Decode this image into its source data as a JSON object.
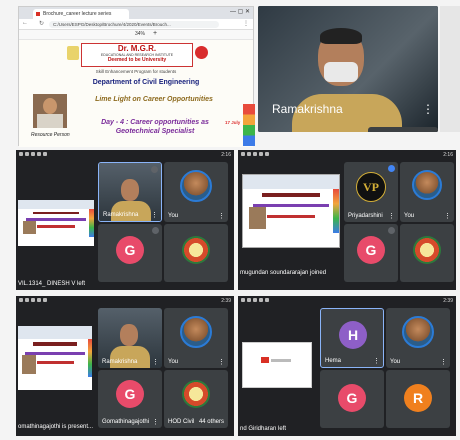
{
  "top": {
    "browser": {
      "tab_title": "Brochure_career lecture series",
      "url": "C:/Users/ESPG/Desktop/Brochure/4/2020/Events/Brouch...",
      "zoom": "34%"
    },
    "slide": {
      "org_name": "Dr. M.G.R.",
      "org_sub": "EDUCATIONAL AND RESEARCH INSTITUTE",
      "deemed": "Deemed to be University",
      "program": "Skill Enhancement Program for students",
      "department": "Department of Civil Engineering",
      "theme": "Lime Light on Career Opportunities",
      "day_title": "Day - 4 : Career opportunities as Geotechnical Specialist",
      "resource_label": "Resource Person",
      "date_badge": "17 July"
    },
    "video_name": "Ramakrishna"
  },
  "screens": [
    {
      "time": "2:16",
      "tiles": [
        {
          "name": "Ramakrishna"
        },
        {
          "name": "You"
        },
        {
          "name": "",
          "avatar_letter": "G",
          "avatar_color": "#e84b6a"
        },
        {
          "name": ""
        }
      ],
      "toast": "VIL.1314_ DINESH V left"
    },
    {
      "time": "2:16",
      "tiles": [
        {
          "name": "Priyadarshini"
        },
        {
          "name": "You"
        },
        {
          "name": "",
          "avatar_letter": "G",
          "avatar_color": "#e84b6a"
        },
        {
          "name": ""
        }
      ],
      "toast": "mugundan soundararajan joined"
    },
    {
      "time": "2:39",
      "tiles": [
        {
          "name": "Ramakrishna"
        },
        {
          "name": "You"
        },
        {
          "name": "Gomathinagajothi",
          "avatar_letter": "G",
          "avatar_color": "#e84b6a"
        },
        {
          "name": "HOD Civil",
          "extra": "44 others"
        }
      ],
      "toast": "omathinagajothi is present..."
    },
    {
      "time": "2:39",
      "tiles": [
        {
          "name": "Hema",
          "avatar_letter": "H",
          "avatar_color": "#8e5fc7"
        },
        {
          "name": "You"
        },
        {
          "name": "",
          "avatar_letter": "G",
          "avatar_color": "#e84b6a"
        },
        {
          "name": "",
          "avatar_letter": "R",
          "avatar_color": "#f0801e"
        }
      ],
      "toast": "nd Giridharan left"
    }
  ]
}
